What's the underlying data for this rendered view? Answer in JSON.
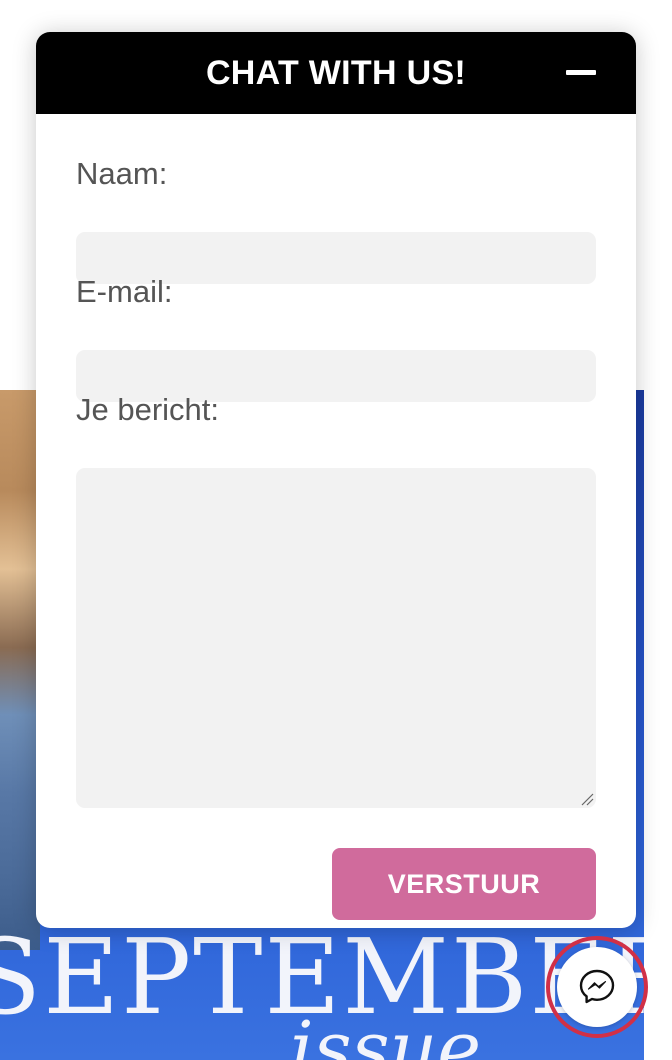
{
  "chat": {
    "title": "CHAT WITH US!",
    "minimize_icon": "minimize-icon",
    "fields": {
      "name_label": "Naam:",
      "name_value": "",
      "email_label": "E-mail:",
      "email_value": "",
      "message_label": "Je bericht:",
      "message_value": ""
    },
    "submit_label": "VERSTUUR"
  },
  "background": {
    "cover_title": "SEPTEMBER",
    "cover_subtitle": "issue"
  },
  "launcher": {
    "icon": "messenger-icon"
  },
  "colors": {
    "header_bg": "#000000",
    "button_bg": "#d06b9c",
    "input_bg": "#f2f2f2",
    "launcher_ring": "#d13047",
    "hero_blue": "#2553c9"
  }
}
